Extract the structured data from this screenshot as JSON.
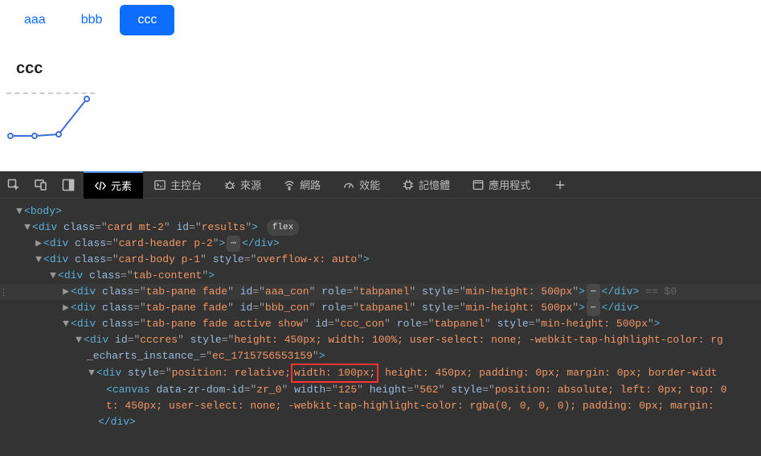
{
  "page": {
    "tabs": [
      {
        "label": "aaa",
        "active": false
      },
      {
        "label": "bbb",
        "active": false
      },
      {
        "label": "ccc",
        "active": true
      }
    ],
    "content_title": "ccc"
  },
  "devtools": {
    "tabs": {
      "elements": "元素",
      "console": "主控台",
      "sources": "來源",
      "network": "網路",
      "performance": "效能",
      "memory": "記憶體",
      "application": "應用程式"
    },
    "dom": {
      "l1": {
        "pre": "<",
        "tag": "body",
        "post": ">"
      },
      "l2": {
        "pre": "<",
        "tag": "div",
        "a1n": "class",
        "a1v": "card mt-2",
        "a2n": "id",
        "a2v": "results",
        "post": ">",
        "pill": "flex"
      },
      "l3": {
        "pre": "<",
        "tag": "div",
        "a1n": "class",
        "a1v": "card-header p-2",
        "post": ">",
        "dots": "⋯",
        "close": "</div>"
      },
      "l4": {
        "pre": "<",
        "tag": "div",
        "a1n": "class",
        "a1v": "card-body p-1",
        "a2n": "style",
        "a2v": "overflow-x: auto",
        "post": ">"
      },
      "l5": {
        "pre": "<",
        "tag": "div",
        "a1n": "class",
        "a1v": "tab-content",
        "post": ">"
      },
      "l6": {
        "pre": "<",
        "tag": "div",
        "a1n": "class",
        "a1v": "tab-pane fade",
        "a2n": "id",
        "a2v": "aaa_con",
        "a3n": "role",
        "a3v": "tabpanel",
        "a4n": "style",
        "a4v": "min-height: 500px",
        "post": ">",
        "dots": "⋯",
        "close": "</div>",
        "hint": "== $0"
      },
      "l7": {
        "pre": "<",
        "tag": "div",
        "a1n": "class",
        "a1v": "tab-pane fade",
        "a2n": "id",
        "a2v": "bbb_con",
        "a3n": "role",
        "a3v": "tabpanel",
        "a4n": "style",
        "a4v": "min-height: 500px",
        "post": ">",
        "dots": "⋯",
        "close": "</div>"
      },
      "l8": {
        "pre": "<",
        "tag": "div",
        "a1n": "class",
        "a1v": "tab-pane fade active show",
        "a2n": "id",
        "a2v": "ccc_con",
        "a3n": "role",
        "a3v": "tabpanel",
        "a4n": "style",
        "a4v": "min-height: 500px",
        "post": ">"
      },
      "l9a": {
        "pre": "<",
        "tag": "div",
        "a1n": "id",
        "a1v": "cccres",
        "a2n": "style",
        "a2v": "height: 450px; width: 100%; user-select: none; -webkit-tap-highlight-color: rg"
      },
      "l9b": {
        "a1n": "_echarts_instance_",
        "a1v": "ec_1715756553159",
        "post": ">"
      },
      "l10": {
        "pre": "<",
        "tag": "div",
        "a1n": "style",
        "a1v_a": "position: relative;",
        "a1v_hl": " width: 100px;",
        "a1v_b": " height: 450px; padding: 0px; margin: 0px; border-widt"
      },
      "l11a": {
        "pre": "<",
        "tag": "canvas",
        "a1n": "data-zr-dom-id",
        "a1v": "zr_0",
        "a2n": "width",
        "a2v": "125",
        "a3n": "height",
        "a3v": "562",
        "a4n": "style",
        "a4v": "position: absolute; left: 0px; top: 0"
      },
      "l11b": {
        "txt": "t: 450px; user-select: none; -webkit-tap-highlight-color: rgba(0, 0, 0, 0); padding: 0px; margin:"
      },
      "l12": {
        "close": "</div>"
      }
    }
  },
  "chart_data": {
    "type": "line",
    "x": [
      0,
      1,
      2,
      3
    ],
    "values": [
      2,
      2,
      3,
      30
    ],
    "xlim": [
      0,
      3
    ],
    "ylim": [
      0,
      35
    ]
  }
}
